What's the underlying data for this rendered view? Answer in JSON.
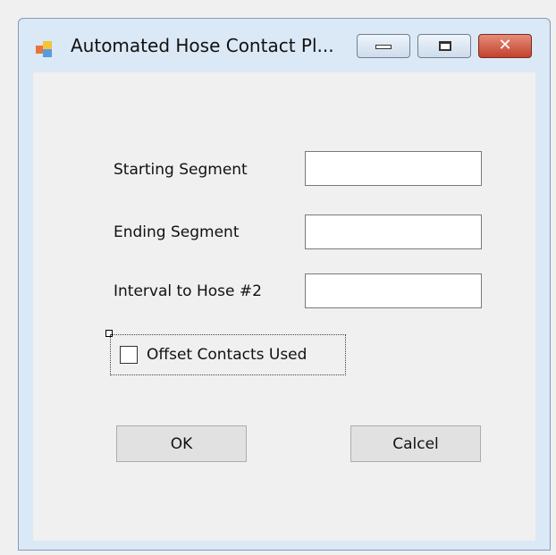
{
  "window": {
    "title": "Automated Hose Contact Pl...",
    "controls": {
      "minimize_icon": "minimize-icon",
      "maximize_icon": "maximize-icon",
      "close_icon": "close-icon",
      "close_glyph": "✕"
    },
    "app_icon": "app-form-icon"
  },
  "form": {
    "starting_segment": {
      "label": "Starting Segment",
      "value": ""
    },
    "ending_segment": {
      "label": "Ending Segment",
      "value": ""
    },
    "interval_hose2": {
      "label": "Interval to Hose #2",
      "value": ""
    },
    "offset_contacts": {
      "label": "Offset Contacts Used",
      "checked": false
    }
  },
  "buttons": {
    "ok_label": "OK",
    "cancel_label": "Calcel"
  },
  "colors": {
    "title_bg": "#dbe8f6",
    "client_bg": "#f0f0f0",
    "close_red": "#c3422c"
  }
}
